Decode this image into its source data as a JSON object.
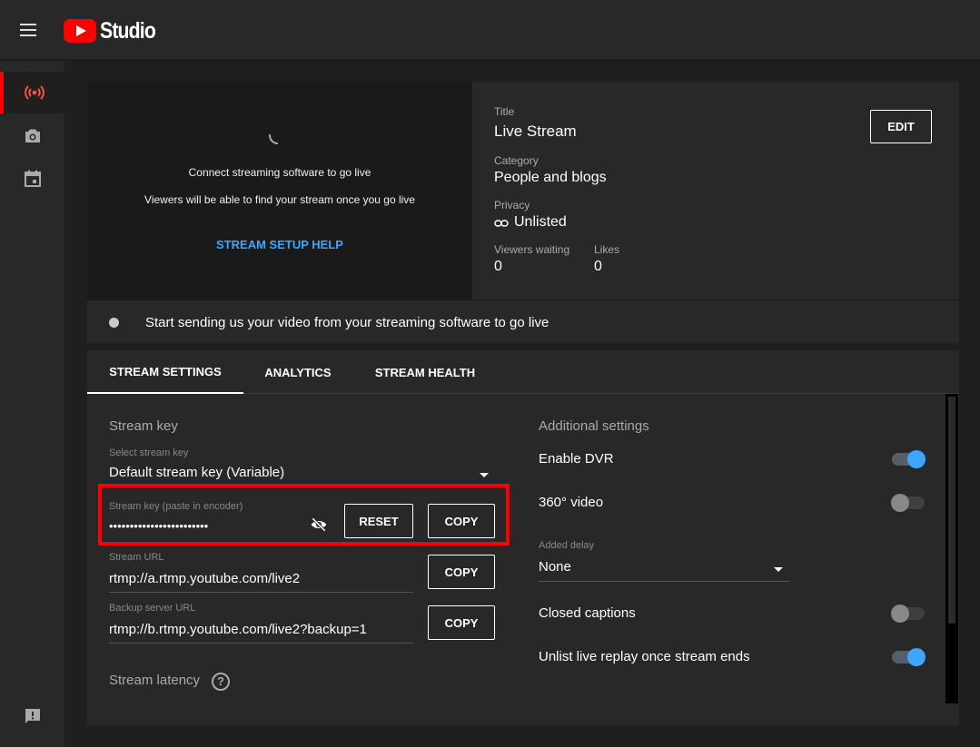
{
  "app": {
    "logo_text": "Studio"
  },
  "preview": {
    "message_primary": "Connect streaming software to go live",
    "message_secondary": "Viewers will be able to find your stream once you go live",
    "help_link": "STREAM SETUP HELP"
  },
  "info": {
    "title_label": "Title",
    "title_value": "Live Stream",
    "category_label": "Category",
    "category_value": "People and blogs",
    "privacy_label": "Privacy",
    "privacy_value": "Unlisted",
    "viewers_label": "Viewers waiting",
    "viewers_value": "0",
    "likes_label": "Likes",
    "likes_value": "0",
    "edit_label": "EDIT"
  },
  "status": {
    "text": "Start sending us your video from your streaming software to go live"
  },
  "tabs": [
    {
      "label": "STREAM SETTINGS",
      "active": true
    },
    {
      "label": "ANALYTICS",
      "active": false
    },
    {
      "label": "STREAM HEALTH",
      "active": false
    }
  ],
  "stream_key": {
    "section_title": "Stream key",
    "select_label": "Select stream key",
    "select_value": "Default stream key (Variable)",
    "key_label": "Stream key (paste in encoder)",
    "key_value": "••••••••••••••••••••••••",
    "reset_label": "RESET",
    "copy_label": "COPY",
    "url_label": "Stream URL",
    "url_value": "rtmp://a.rtmp.youtube.com/live2",
    "backup_label": "Backup server URL",
    "backup_value": "rtmp://b.rtmp.youtube.com/live2?backup=1",
    "latency_title": "Stream latency",
    "latency_help": "?"
  },
  "additional": {
    "section_title": "Additional settings",
    "dvr_label": "Enable DVR",
    "dvr_on": true,
    "video360_label": "360° video",
    "video360_on": false,
    "delay_label": "Added delay",
    "delay_value": "None",
    "captions_label": "Closed captions",
    "captions_on": false,
    "unlist_label": "Unlist live replay once stream ends",
    "unlist_on": true
  },
  "colors": {
    "accent": "#3ea6ff",
    "brand": "#ff0000",
    "highlight": "#ff0000"
  }
}
